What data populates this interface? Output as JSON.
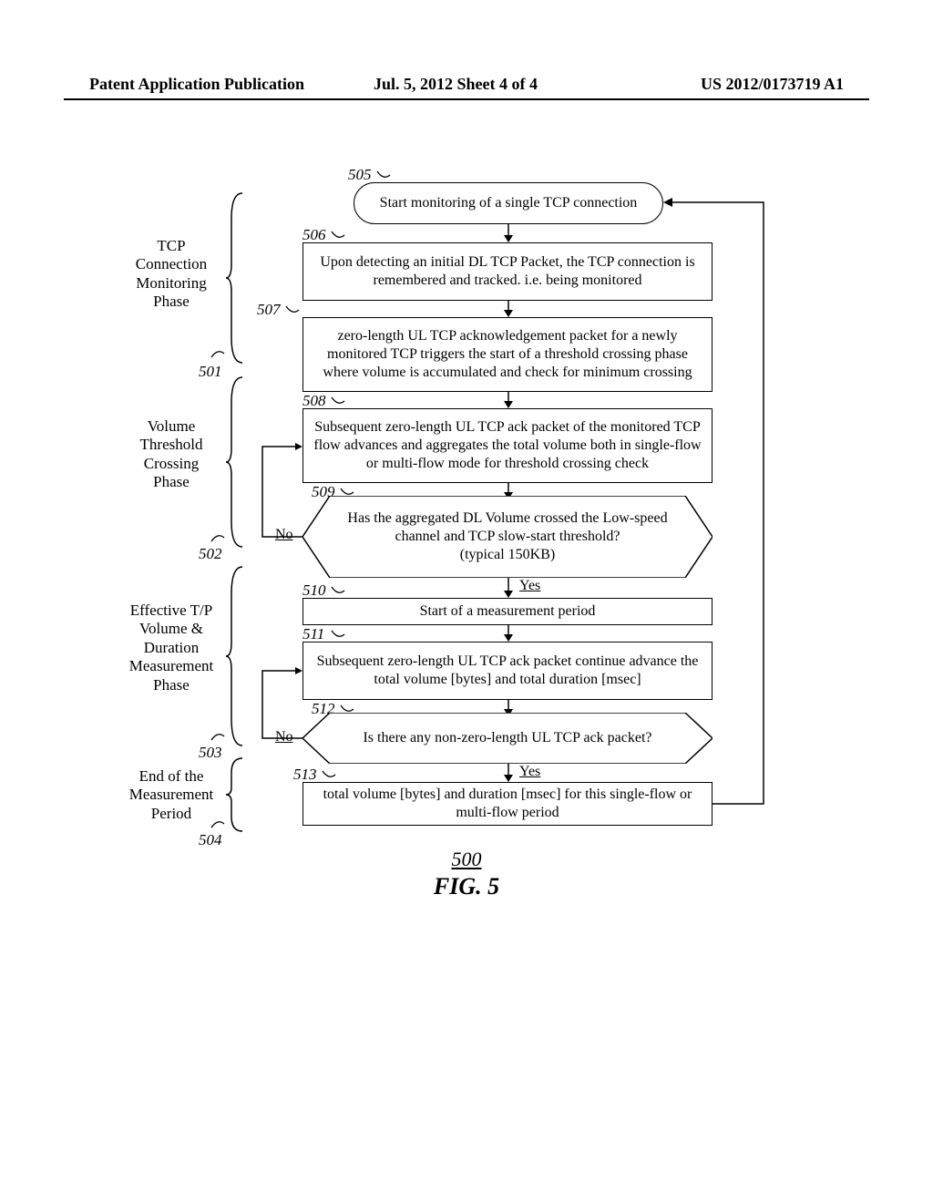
{
  "header": {
    "left": "Patent Application Publication",
    "center": "Jul. 5, 2012  Sheet 4 of 4",
    "right": "US 2012/0173719 A1"
  },
  "phases": {
    "p501": {
      "label": "TCP\nConnection\nMonitoring\nPhase",
      "num": "501"
    },
    "p502": {
      "label": "Volume\nThreshold\nCrossing\nPhase",
      "num": "502"
    },
    "p503": {
      "label": "Effective T/P\nVolume &\nDuration\nMeasurement\nPhase",
      "num": "503"
    },
    "p504": {
      "label": "End of the\nMeasurement\nPeriod",
      "num": "504"
    }
  },
  "steps": {
    "s505": {
      "num": "505",
      "text": "Start monitoring of a single TCP connection"
    },
    "s506": {
      "num": "506",
      "text": "Upon detecting an initial DL TCP Packet, the TCP connection is remembered and tracked. i.e. being monitored"
    },
    "s507": {
      "num": "507",
      "text": "zero-length UL TCP acknowledgement packet for a newly monitored TCP triggers the start of a threshold crossing phase where volume is accumulated and check for minimum crossing"
    },
    "s508": {
      "num": "508",
      "text": "Subsequent zero-length UL TCP ack packet of the monitored TCP flow advances and aggregates the total volume both in single-flow or multi-flow mode for threshold crossing check"
    },
    "s509": {
      "num": "509",
      "text": "Has the aggregated DL Volume crossed the Low-speed channel and TCP slow-start threshold?\n(typical 150KB)"
    },
    "s510": {
      "num": "510",
      "text": "Start of a measurement period"
    },
    "s511": {
      "num": "511",
      "text": "Subsequent zero-length UL TCP ack packet continue advance the total volume [bytes] and total duration [msec]"
    },
    "s512": {
      "num": "512",
      "text": "Is there any non-zero-length UL TCP ack packet?"
    },
    "s513": {
      "num": "513",
      "text": "total volume [bytes] and duration [msec] for this single-flow or multi-flow period"
    }
  },
  "decisions": {
    "no": "No",
    "yes": "Yes"
  },
  "figure": {
    "num": "500",
    "caption": "FIG. 5"
  },
  "chart_data": {
    "type": "flowchart",
    "title": "FIG. 5",
    "figure_number": 500,
    "phases": [
      {
        "id": 501,
        "name": "TCP Connection Monitoring Phase",
        "steps": [
          505,
          506,
          507
        ]
      },
      {
        "id": 502,
        "name": "Volume Threshold Crossing Phase",
        "steps": [
          508,
          509
        ]
      },
      {
        "id": 503,
        "name": "Effective T/P Volume & Duration Measurement Phase",
        "steps": [
          510,
          511,
          512
        ]
      },
      {
        "id": 504,
        "name": "End of the Measurement Period",
        "steps": [
          513
        ]
      }
    ],
    "nodes": [
      {
        "id": 505,
        "type": "terminator",
        "text": "Start monitoring of a single TCP connection"
      },
      {
        "id": 506,
        "type": "process",
        "text": "Upon detecting an initial DL TCP Packet, the TCP connection is remembered and tracked. i.e. being monitored"
      },
      {
        "id": 507,
        "type": "process",
        "text": "zero-length UL TCP acknowledgement packet for a newly monitored TCP triggers the start of a threshold crossing phase where volume is accumulated and check for minimum crossing"
      },
      {
        "id": 508,
        "type": "process",
        "text": "Subsequent zero-length UL TCP ack packet of the monitored TCP flow advances and aggregates the total volume both in single-flow or multi-flow mode for threshold crossing check"
      },
      {
        "id": 509,
        "type": "decision",
        "text": "Has the aggregated DL Volume crossed the Low-speed channel and TCP slow-start threshold? (typical 150KB)"
      },
      {
        "id": 510,
        "type": "process",
        "text": "Start of a measurement period"
      },
      {
        "id": 511,
        "type": "process",
        "text": "Subsequent zero-length UL TCP ack packet continue advance the total volume [bytes] and total duration [msec]"
      },
      {
        "id": 512,
        "type": "decision",
        "text": "Is there any non-zero-length UL TCP ack packet?"
      },
      {
        "id": 513,
        "type": "process",
        "text": "total volume [bytes] and duration [msec] for this single-flow or multi-flow period"
      }
    ],
    "edges": [
      {
        "from": 505,
        "to": 506
      },
      {
        "from": 506,
        "to": 507
      },
      {
        "from": 507,
        "to": 508
      },
      {
        "from": 508,
        "to": 509
      },
      {
        "from": 509,
        "to": 508,
        "label": "No"
      },
      {
        "from": 509,
        "to": 510,
        "label": "Yes"
      },
      {
        "from": 510,
        "to": 511
      },
      {
        "from": 511,
        "to": 512
      },
      {
        "from": 512,
        "to": 511,
        "label": "No"
      },
      {
        "from": 512,
        "to": 513,
        "label": "Yes"
      },
      {
        "from": 513,
        "to": 505,
        "note": "loop back"
      }
    ]
  }
}
